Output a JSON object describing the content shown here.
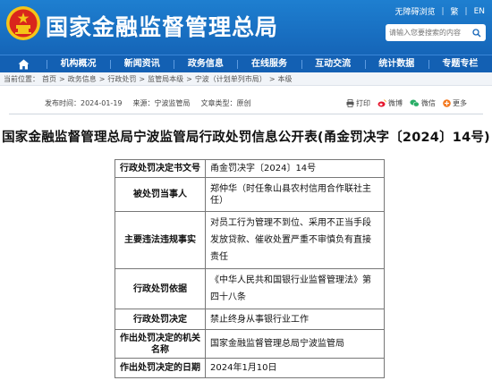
{
  "header": {
    "site_title": "国家金融监督管理总局",
    "links": [
      "无障碍浏览",
      "繁",
      "EN"
    ],
    "search_placeholder": "请输入您要搜索的内容"
  },
  "nav": {
    "items": [
      "机构概况",
      "新闻资讯",
      "政务信息",
      "在线服务",
      "互动交流",
      "统计数据",
      "专题专栏"
    ]
  },
  "breadcrumb": {
    "prefix": "当前位置：",
    "items": [
      "首页",
      "政务信息",
      "行政处罚",
      "监管局本级",
      "宁波（计划单列市局）",
      "本级"
    ],
    "separator": ">"
  },
  "meta": {
    "date_label": "发布时间：",
    "date": "2024-01-19",
    "source_label": "来源：",
    "source": "宁波监管局",
    "type_label": "文章类型：",
    "type": "原创"
  },
  "share": {
    "print": "打印",
    "weibo": "微博",
    "wechat": "微信",
    "more": "更多"
  },
  "document": {
    "title": "国家金融监督管理总局宁波监管局行政处罚信息公开表(甬金罚决字〔2024〕14号)",
    "rows": [
      {
        "label": "行政处罚决定书文号",
        "value": "甬金罚决字〔2024〕14号"
      },
      {
        "label": "被处罚当事人",
        "value": "郑仲华（时任象山县农村信用合作联社主任）"
      },
      {
        "label": "主要违法违规事实",
        "value": "对员工行为管理不到位、采用不正当手段发放贷款、催收处置严重不审慎负有直接责任"
      },
      {
        "label": "行政处罚依据",
        "value": "《中华人民共和国银行业监督管理法》第四十八条"
      },
      {
        "label": "行政处罚决定",
        "value": "禁止终身从事银行业工作"
      },
      {
        "label": "作出处罚决定的机关名称",
        "value": "国家金融监督管理总局宁波监管局"
      },
      {
        "label": "作出处罚决定的日期",
        "value": "2024年1月10日"
      }
    ]
  },
  "colors": {
    "header_blue": "#1e7fd0",
    "nav_blue": "#1360b3",
    "emblem_red": "#d9261c",
    "emblem_gold": "#f5c518"
  }
}
